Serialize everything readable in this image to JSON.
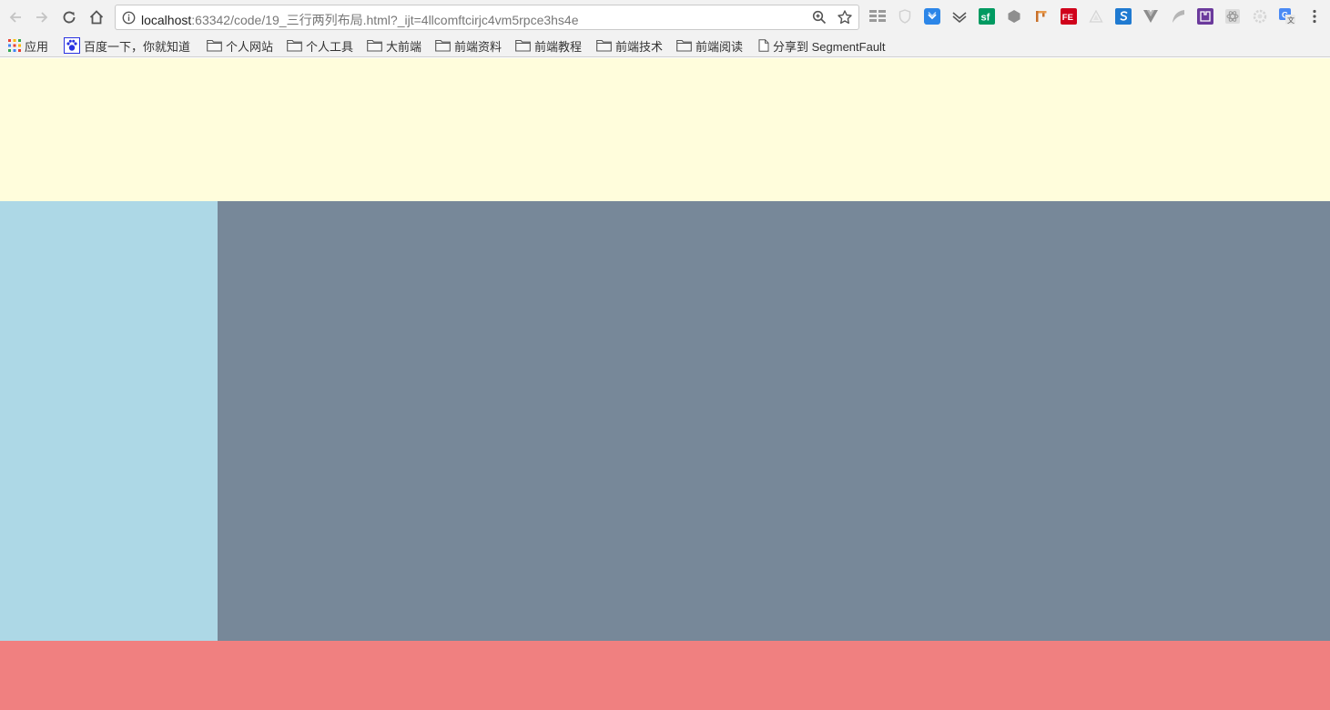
{
  "browser": {
    "url_host": "localhost",
    "url_rest": ":63342/code/19_三行两列布局.html?_ijt=4llcomftcirjc4vm5rpce3hs4e",
    "extensions": [
      "grid-icon",
      "shield-icon",
      "pocket-icon",
      "feedly-icon",
      "segmentfault-icon",
      "cube-icon",
      "flag-icon",
      "fe-icon",
      "triangle-icon",
      "sketch-icon",
      "vue-icon",
      "wing-icon",
      "puzzle-icon",
      "react-icon",
      "settings-icon",
      "translate-icon"
    ],
    "bookmarks": [
      {
        "label": "应用",
        "icon": "apps-icon"
      },
      {
        "label": "百度一下，你就知道",
        "icon": "baidu-icon"
      },
      {
        "label": "个人网站",
        "icon": "folder-icon"
      },
      {
        "label": "个人工具",
        "icon": "folder-icon"
      },
      {
        "label": "大前端",
        "icon": "folder-icon"
      },
      {
        "label": "前端资料",
        "icon": "folder-icon"
      },
      {
        "label": "前端教程",
        "icon": "folder-icon"
      },
      {
        "label": "前端技术",
        "icon": "folder-icon"
      },
      {
        "label": "前端阅读",
        "icon": "folder-icon"
      },
      {
        "label": "分享到 SegmentFault",
        "icon": "page-icon"
      }
    ]
  },
  "layout_colors": {
    "header": "#fffddc",
    "left": "#add8e6",
    "main": "#778899",
    "footer": "#f08080"
  }
}
